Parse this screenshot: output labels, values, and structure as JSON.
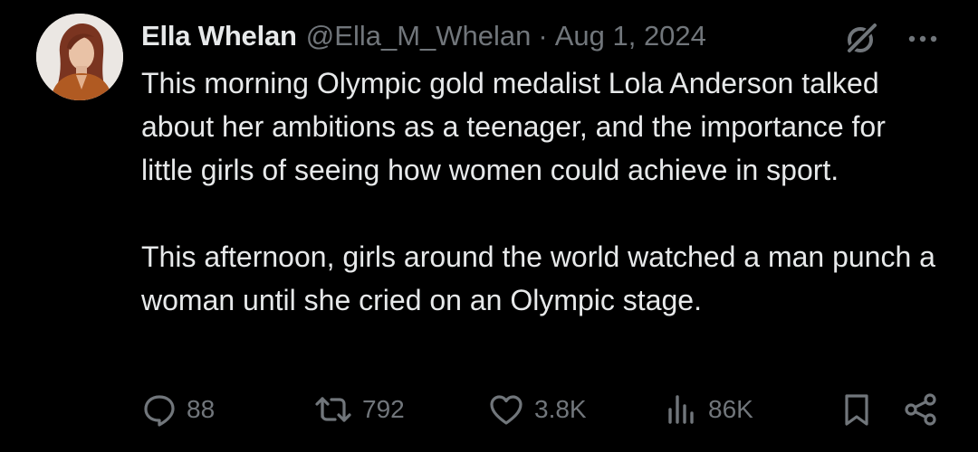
{
  "author": {
    "display_name": "Ella Whelan",
    "handle": "@Ella_M_Whelan",
    "separator": "·",
    "date": "Aug 1, 2024"
  },
  "tweet": {
    "paragraphs": [
      "This morning Olympic gold medalist Lola Anderson talked about her ambitions as a teenager, and the importance for little girls of seeing how women could achieve in sport.",
      "This afternoon, girls around the world watched a man punch a woman until she cried on an Olympic stage."
    ]
  },
  "actions": {
    "replies": "88",
    "reposts": "792",
    "likes": "3.8K",
    "views": "86K"
  },
  "icons": {
    "header": [
      "grok-icon",
      "more-icon"
    ],
    "actions": [
      "reply-icon",
      "repost-icon",
      "like-icon",
      "views-icon",
      "bookmark-icon",
      "share-icon"
    ]
  },
  "colors": {
    "background": "#000000",
    "primary_text": "#e7e9ea",
    "secondary_text": "#71767b"
  }
}
